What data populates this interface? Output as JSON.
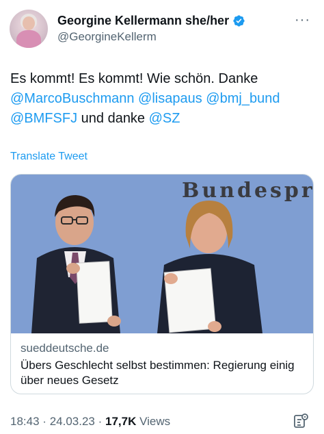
{
  "author": {
    "display_name": "Georgine Kellermann she/her",
    "handle": "@GeorgineKellerm",
    "avatar_icon": "profile-photo"
  },
  "tweet": {
    "text_parts": [
      "Es kommt! Es kommt! Wie schön. Danke",
      "@MarcoBuschmann",
      "@lisapaus",
      "@bmj_bund",
      "@BMFSFJ",
      "und danke",
      "@SZ"
    ],
    "translate_label": "Translate Tweet"
  },
  "link_card": {
    "image_wall_text": "Bundespress",
    "domain": "sueddeutsche.de",
    "title": "Übers Geschlecht selbst bestimmen: Regierung einig über neues Gesetz"
  },
  "meta": {
    "time": "18:43",
    "separator": "·",
    "date": "24.03.23",
    "views_count": "17,7K",
    "views_label": "Views"
  },
  "colors": {
    "accent": "#1d9bf0",
    "secondary_text": "#536471",
    "primary_text": "#0f1419",
    "border": "#cfd9de"
  }
}
